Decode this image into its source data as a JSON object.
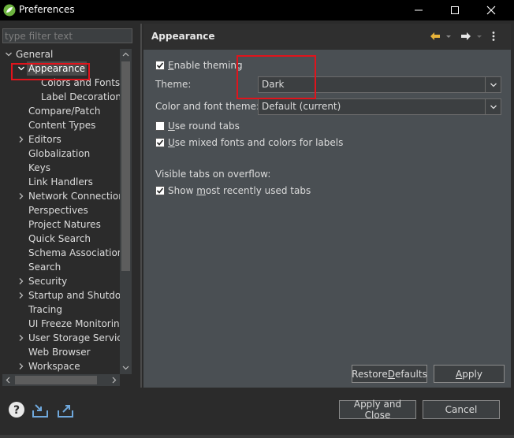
{
  "window": {
    "title": "Preferences",
    "minimize_glyph": "—",
    "maximize_glyph": "☐",
    "close_glyph": "✕"
  },
  "filter": {
    "placeholder": "type filter text"
  },
  "tree": {
    "items": [
      {
        "label": "General",
        "chevron": "down"
      },
      {
        "label": "Appearance",
        "chevron": "down",
        "selected": true
      },
      {
        "label": "Colors and Fonts"
      },
      {
        "label": "Label Decorations"
      },
      {
        "label": "Compare/Patch"
      },
      {
        "label": "Content Types"
      },
      {
        "label": "Editors",
        "chevron": "right"
      },
      {
        "label": "Globalization"
      },
      {
        "label": "Keys"
      },
      {
        "label": "Link Handlers"
      },
      {
        "label": "Network Connections",
        "chevron": "right"
      },
      {
        "label": "Perspectives"
      },
      {
        "label": "Project Natures"
      },
      {
        "label": "Quick Search"
      },
      {
        "label": "Schema Associations"
      },
      {
        "label": "Search"
      },
      {
        "label": "Security",
        "chevron": "right"
      },
      {
        "label": "Startup and Shutdown",
        "chevron": "right"
      },
      {
        "label": "Tracing"
      },
      {
        "label": "UI Freeze Monitoring"
      },
      {
        "label": "User Storage Service",
        "chevron": "right"
      },
      {
        "label": "Web Browser"
      },
      {
        "label": "Workspace",
        "chevron": "right"
      }
    ]
  },
  "header": {
    "title": "Appearance",
    "icons": [
      "back-arrow-icon",
      "back-dropdown-icon",
      "forward-arrow-icon",
      "forward-dropdown-icon",
      "view-menu-icon"
    ]
  },
  "appearance": {
    "enable_theming": {
      "pre": "",
      "mnemonic": "E",
      "post": "nable theming",
      "checked": true
    },
    "theme_label": "Theme:",
    "theme_value": "Dark",
    "color_font_label": "Color and font theme:",
    "color_font_value": "Default (current)",
    "round_tabs": {
      "pre": "",
      "mnemonic": "U",
      "post": "se round tabs",
      "checked": false
    },
    "mixed_fonts": {
      "pre": "",
      "mnemonic": "U",
      "post": "se mixed fonts and colors for labels",
      "checked": true
    },
    "visible_tabs_label": "Visible tabs on overflow:",
    "show_recent": {
      "pre": "Show ",
      "mnemonic": "m",
      "post": "ost recently used tabs",
      "checked": true
    }
  },
  "buttons": {
    "restore_defaults": {
      "pre": "Restore ",
      "mnemonic": "D",
      "post": "efaults"
    },
    "apply": {
      "pre": "",
      "mnemonic": "A",
      "post": "pply"
    },
    "apply_close": "Apply and Close",
    "cancel": "Cancel"
  },
  "colors": {
    "accent_red": "#e0141c",
    "titlebar": "#000000",
    "content_bg": "#4a4f53",
    "back_arrow": "#e8b33a"
  },
  "bottom_icons": [
    "help-icon",
    "import-icon",
    "export-icon"
  ]
}
